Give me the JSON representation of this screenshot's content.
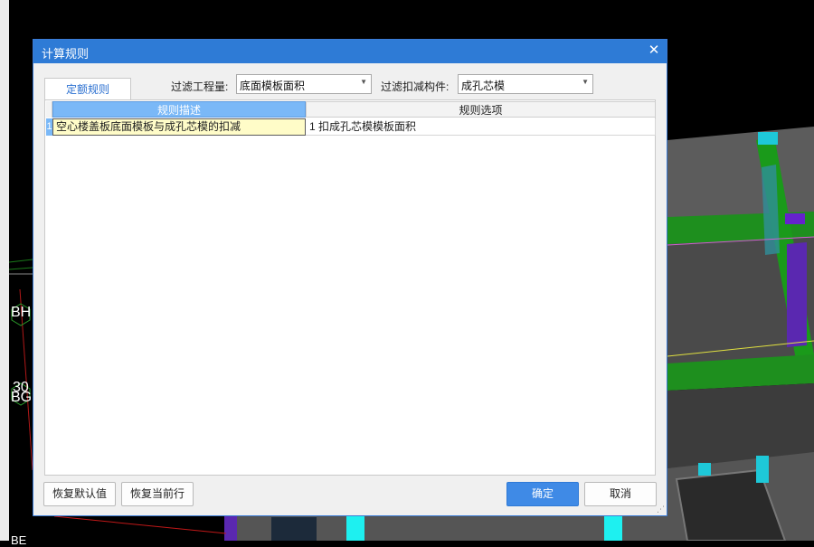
{
  "dialog": {
    "title": "计算规则",
    "tab_label": "定额规则",
    "filter_quantity_label": "过滤工程量:",
    "filter_quantity_value": "底面模板面积",
    "filter_component_label": "过滤扣减构件:",
    "filter_component_value": "成孔芯模",
    "columns": [
      "规则描述",
      "规则选项"
    ],
    "rows": [
      {
        "num": "1",
        "desc": "空心楼盖板底面模板与成孔芯模的扣减",
        "option": "1 扣成孔芯模模板面积"
      }
    ],
    "buttons": {
      "restore_default": "恢复默认值",
      "restore_current": "恢复当前行",
      "ok": "确定",
      "cancel": "取消"
    }
  },
  "background": {
    "labels": [
      "BH",
      "30",
      "BG",
      "BE"
    ]
  },
  "colors": {
    "titlebar": "#2e7bd6",
    "header_selected": "#7ab8f7",
    "primary_button": "#3f8ae6",
    "cell_highlight": "#fffcc8"
  }
}
